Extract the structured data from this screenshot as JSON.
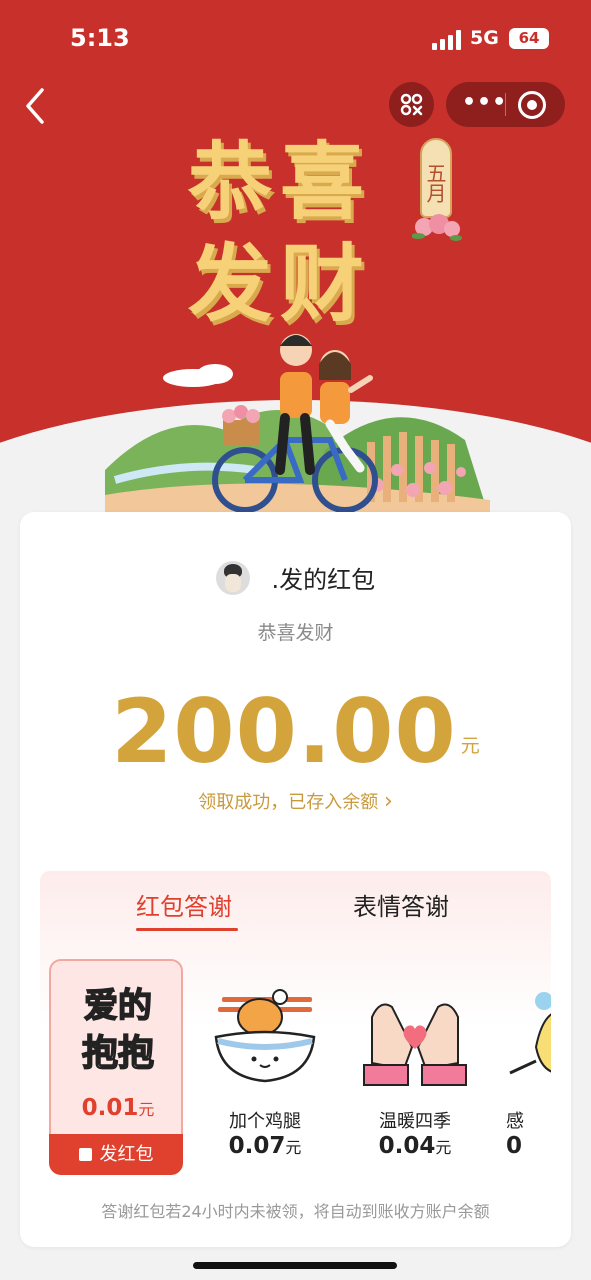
{
  "status_bar": {
    "time": "5:13",
    "network": "5G",
    "battery": "64"
  },
  "banner": {
    "line1": "恭喜",
    "line2": "发财",
    "month_tag": "五月"
  },
  "packet": {
    "sender_name": ".发的红包",
    "blessing": "恭喜发财",
    "amount": "200.00",
    "amount_unit": "元",
    "received_text": "领取成功，已存入余额",
    "received_arrow": "›"
  },
  "thanks": {
    "tabs": [
      {
        "label": "红包答谢",
        "active": true
      },
      {
        "label": "表情答谢",
        "active": false
      }
    ],
    "gifts": [
      {
        "art_text_1": "爱的",
        "art_text_2": "抱抱",
        "price": "0.01",
        "unit": "元",
        "selected": true,
        "send_label": "发红包"
      },
      {
        "name": "加个鸡腿",
        "price": "0.07",
        "unit": "元"
      },
      {
        "name": "温暖四季",
        "price": "0.04",
        "unit": "元"
      },
      {
        "name": "感",
        "price": "0"
      }
    ],
    "hint": "答谢红包若24小时内未被领，将自动到账收方账户余额"
  },
  "colors": {
    "hero_red": "#c8302c",
    "gold": "#d3a43b",
    "accent_red": "#e0412f"
  }
}
